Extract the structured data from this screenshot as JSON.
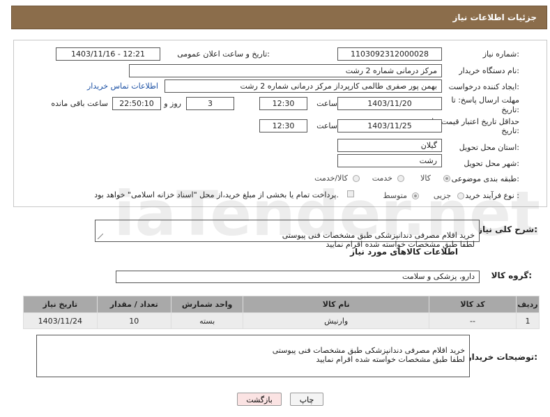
{
  "header": {
    "title": "جزئیات اطلاعات نیاز"
  },
  "form": {
    "need_number_label": "شماره نیاز:",
    "need_number": "1103092312000028",
    "announce_label": "تاریخ و ساعت اعلان عمومی:",
    "announce_value": "1403/11/16 - 12:21",
    "buyer_org_label": "نام دستگاه خریدار:",
    "buyer_org": "مرکز درمانی شماره 2 رشت",
    "creator_label": "ایجاد کننده درخواست:",
    "creator": "بهمن پور صفری طالمی کارپرداز مرکز درمانی شماره 2 رشت",
    "contact_link": "اطلاعات تماس خریدار",
    "deadline_label_1": "مهلت ارسال پاسخ: تا",
    "deadline_label_2": "تاریخ:",
    "deadline_date": "1403/11/20",
    "time_label": "ساعت",
    "deadline_time": "12:30",
    "days_value": "3",
    "days_label": "روز و",
    "remaining_time": "22:50:10",
    "remaining_label": "ساعت باقی مانده",
    "validity_label_1": "حداقل تاریخ اعتبار قیمت: تا",
    "validity_label_2": "تاریخ:",
    "validity_date": "1403/11/25",
    "validity_time": "12:30",
    "province_label": "استان محل تحویل:",
    "province": "گیلان",
    "city_label": "شهر محل تحویل:",
    "city": "رشت",
    "category_label": "طبقه بندی موضوعی:",
    "category_options": [
      "کالا",
      "خدمت",
      "کالا/خدمت"
    ],
    "process_label": "نوع فرآیند خرید :",
    "process_options": [
      "جزیی",
      "متوسط"
    ],
    "payment_note": "پرداخت تمام یا بخشی از مبلغ خرید،از محل \"اسناد خزانه اسلامی\" خواهد بود."
  },
  "summary": {
    "label": "شرح کلی نیاز:",
    "text": "خرید اقلام مصرفی  دندانپزشکی طبق مشخصات فنی پیوستی\nلطفا طبق مشخصات خواسته شده اقرام نمایید"
  },
  "goods": {
    "section_title": "اطلاعات کالاهای مورد نیاز",
    "group_label": "گروه کالا:",
    "group_value": "دارو، پزشکی و سلامت",
    "columns": [
      "ردیف",
      "کد کالا",
      "نام کالا",
      "واحد شمارش",
      "تعداد / مقدار",
      "تاریخ نیاز"
    ],
    "rows": [
      {
        "index": "1",
        "code": "--",
        "name": "وارنیش",
        "unit": "بسته",
        "qty": "10",
        "date": "1403/11/24"
      }
    ]
  },
  "buyer_notes": {
    "label": "توضیحات خریدار:",
    "text": "خرید اقلام مصرفی دندانپزشکی طبق مشخصات فنی پیوستی\nلطفا طبق مشخصات خواسته شده اقرام نمایید"
  },
  "buttons": {
    "print": "چاپ",
    "back": "بازگشت"
  },
  "watermark": {
    "text": "AriaTender.net"
  },
  "colors": {
    "header": "#8b6d4b",
    "table_header": "#a9a9a9",
    "link": "#1a4fa3",
    "back_button": "#fbe3e3"
  }
}
